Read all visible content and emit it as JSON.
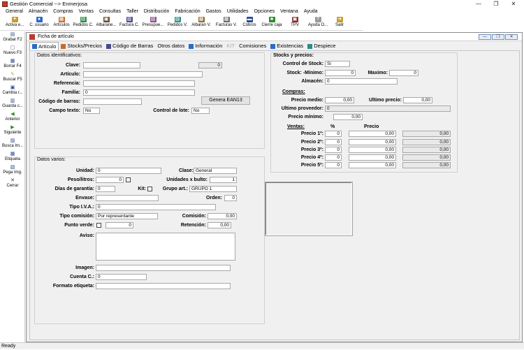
{
  "app": {
    "title": "Gestión Comercial --> Enmerjosa"
  },
  "menu": [
    "General",
    "Almacén",
    "Compras",
    "Ventas",
    "Consultas",
    "Taller",
    "Distribución",
    "Fabricación",
    "Gastos",
    "Utilidades",
    "Opciones",
    "Ventana",
    "Ayuda"
  ],
  "toolbar": [
    {
      "label": "Activa e...",
      "icon": "activate-icon",
      "color": "#c89b2a"
    },
    {
      "label": "C. usuario",
      "icon": "user-icon",
      "color": "#2a6bc8"
    },
    {
      "label": "Artículos",
      "icon": "articles-icon",
      "color": "#c86b2a"
    },
    {
      "label": "Pedidos C.",
      "icon": "orders-icon",
      "color": "#2a8c4a"
    },
    {
      "label": "Albarane...",
      "icon": "delivery-icon",
      "color": "#6b4a2a"
    },
    {
      "label": "Factura C.",
      "icon": "invoice-icon",
      "color": "#4a4a8c"
    },
    {
      "label": "Presupue...",
      "icon": "quote-icon",
      "color": "#8c4a8c"
    },
    {
      "label": "Pedidos V.",
      "icon": "sales-orders-icon",
      "color": "#2a8c8c"
    },
    {
      "label": "Albaran V.",
      "icon": "sales-delivery-icon",
      "color": "#8c6b2a"
    },
    {
      "label": "Facturas V.",
      "icon": "sales-invoice-icon",
      "color": "#6b6b6b"
    },
    {
      "label": "Cobros",
      "icon": "collections-icon",
      "color": "#2a4a8c"
    },
    {
      "label": "Cierre caja",
      "icon": "cash-close-icon",
      "color": "#2a8c2a"
    },
    {
      "label": "TPV",
      "icon": "pos-icon",
      "color": "#8c2a2a"
    },
    {
      "label": "Ayuda O...",
      "icon": "help-icon",
      "color": "#9a9a9a"
    },
    {
      "label": "Salir",
      "icon": "exit-icon",
      "color": "#c8a02a"
    }
  ],
  "sidebar": [
    {
      "label": "Grabar F2",
      "icon": "save-icon"
    },
    {
      "label": "Nuevo F3",
      "icon": "new-icon"
    },
    {
      "label": "Borrar F4",
      "icon": "delete-icon"
    },
    {
      "label": "Buscar F5",
      "icon": "search-icon"
    },
    {
      "label": "Cambia r...",
      "icon": "change-icon"
    },
    {
      "label": "Guarda c...",
      "icon": "store-icon"
    },
    {
      "label": "Anterior",
      "icon": "previous-icon"
    },
    {
      "label": "Siguiente",
      "icon": "next-icon"
    },
    {
      "label": "Busca Im...",
      "icon": "search-image-icon"
    },
    {
      "label": "Etiqueta",
      "icon": "label-icon"
    },
    {
      "label": "Pega Img.",
      "icon": "paste-image-icon"
    },
    {
      "label": "Cerrar",
      "icon": "close-icon"
    }
  ],
  "child": {
    "title": "Ficha de artículo"
  },
  "tabs": [
    {
      "label": "Artículo",
      "active": true
    },
    {
      "label": "Stocks/Precios"
    },
    {
      "label": "Código de Barras"
    },
    {
      "label": "Otros datos"
    },
    {
      "label": "Información"
    },
    {
      "label": "KIT",
      "disabled": true
    },
    {
      "label": "Comisiones"
    },
    {
      "label": "Existencias"
    },
    {
      "label": "Despiece"
    }
  ],
  "ident": {
    "title": "Datos identificativos:",
    "clave_label": "Clave:",
    "clave": "",
    "clave_num": "0",
    "articulo_label": "Artículo:",
    "articulo": "",
    "referencia_label": "Referencia:",
    "referencia": "",
    "familia_label": "Familia:",
    "familia": "0",
    "barras_label": "Código de barras:",
    "barras": "",
    "genera_label": "Genera EAN13",
    "campo_label": "Campo texto:",
    "campo": "No",
    "lote_label": "Control de lote:",
    "lote": "No"
  },
  "varios": {
    "title": "Datos varios:",
    "unidad_label": "Unidad:",
    "unidad": "0",
    "clase_label": "Clase:",
    "clase": "General",
    "peso_label": "Peso/litros:",
    "peso": "0",
    "unidades_label": "Unidades x bulto:",
    "unidades": "1",
    "garantia_label": "Días de garantía:",
    "garantia": "0",
    "kit_label": "Kit:",
    "grupo_label": "Grupo art.:",
    "grupo": "GRUPO 1",
    "envase_label": "Envase:",
    "envase": "",
    "orden_label": "Orden:",
    "orden": "0",
    "iva_label": "Tipo I.V.A.:",
    "iva": "0",
    "tcomision_label": "Tipo comisión:",
    "tcomision": "Por representante",
    "comision_label": "Comisión:",
    "comision": "0,00",
    "punto_label": "Punto verde:",
    "punto": "0",
    "retencion_label": "Retención:",
    "retencion": "0,00",
    "aviso_label": "Aviso:",
    "aviso": "",
    "imagen_label": "Imagen:",
    "imagen": "",
    "cuenta_label": "Cuenta C.:",
    "cuenta": "0",
    "formato_label": "Formato etiqueta:",
    "formato": ""
  },
  "stocks": {
    "title": "Stocks y precios:",
    "control_label": "Control de Stock:",
    "control": "Si",
    "minimo_label": "Stock: -Mínimo:",
    "minimo": "0",
    "maximo_label": "Maximo:",
    "maximo": "0",
    "almacen_label": "Almacén:",
    "almacen": "0",
    "compras_label": "Compras:",
    "pmedio_label": "Precio medio:",
    "pmedio": "0,00",
    "uprecio_label": "Ultimo precio:",
    "uprecio": "0,00",
    "uproveedor_label": "Ultimo proveedor:",
    "uproveedor": "0",
    "pminimo_label": "Precio mínimo:",
    "pminimo": "0,00",
    "ventas_label": "Ventas:",
    "pct_header": "%",
    "precio_header": "Precio",
    "precios": [
      {
        "label": "Precio 1º:",
        "pct": "0",
        "precio": "0,00",
        "extra": "0,00"
      },
      {
        "label": "Precio 2º:",
        "pct": "0",
        "precio": "0,00",
        "extra": "0,00"
      },
      {
        "label": "Precio 3º:",
        "pct": "0",
        "precio": "0,00",
        "extra": "0,00"
      },
      {
        "label": "Precio 4º:",
        "pct": "0",
        "precio": "0,00",
        "extra": "0,00"
      },
      {
        "label": "Precio 5º:",
        "pct": "0",
        "precio": "0,00",
        "extra": "0,00"
      }
    ]
  },
  "status": {
    "text": "Ready"
  }
}
